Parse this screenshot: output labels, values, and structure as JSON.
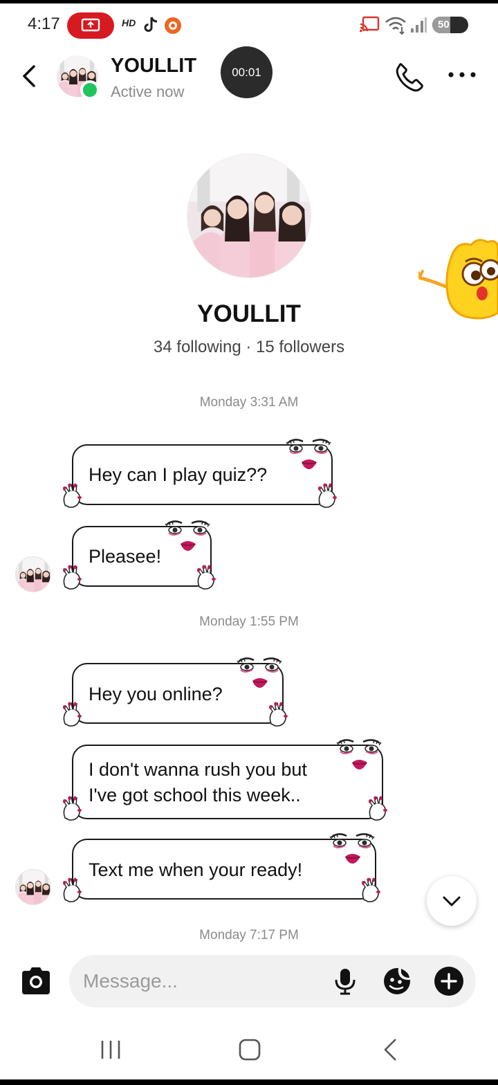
{
  "status_bar": {
    "time": "4:17",
    "hd_label": "HD",
    "battery": "50",
    "battery_level": 0.5,
    "icons": [
      "screen-record-icon",
      "tiktok-icon",
      "orange-app-icon",
      "cast-icon",
      "wifi-icon",
      "signal-icon",
      "battery-icon"
    ]
  },
  "header": {
    "name": "YOULLIT",
    "status": "Active now",
    "timer": "00:01",
    "icons": [
      "back-arrow-icon",
      "phone-icon",
      "more-icon"
    ]
  },
  "profile": {
    "name": "YOULLIT",
    "stats": "34 following · 15 followers"
  },
  "messages": {
    "groups": [
      {
        "timestamp": "Monday 3:31 AM",
        "items": [
          {
            "text": "Hey can I play quiz??"
          },
          {
            "text": "Pleasee!"
          }
        ]
      },
      {
        "timestamp": "Monday 1:55 PM",
        "items": [
          {
            "text": "Hey you online?"
          },
          {
            "text_line1": "I don't wanna rush you but",
            "text_line2": "I've got school this week.."
          },
          {
            "text": "Text me when your ready!"
          }
        ]
      },
      {
        "timestamp": "Monday 7:17 PM",
        "items": []
      }
    ]
  },
  "composer": {
    "placeholder": "Message...",
    "icons": [
      "camera-icon",
      "microphone-icon",
      "sticker-icon",
      "plus-icon"
    ]
  },
  "nav": {
    "icons": [
      "recent-apps-icon",
      "home-icon",
      "back-icon"
    ]
  },
  "colors": {
    "online": "#21c55d",
    "record": "#d71921",
    "lips": "#c2185b",
    "timer_bg": "#2b2b2b"
  }
}
